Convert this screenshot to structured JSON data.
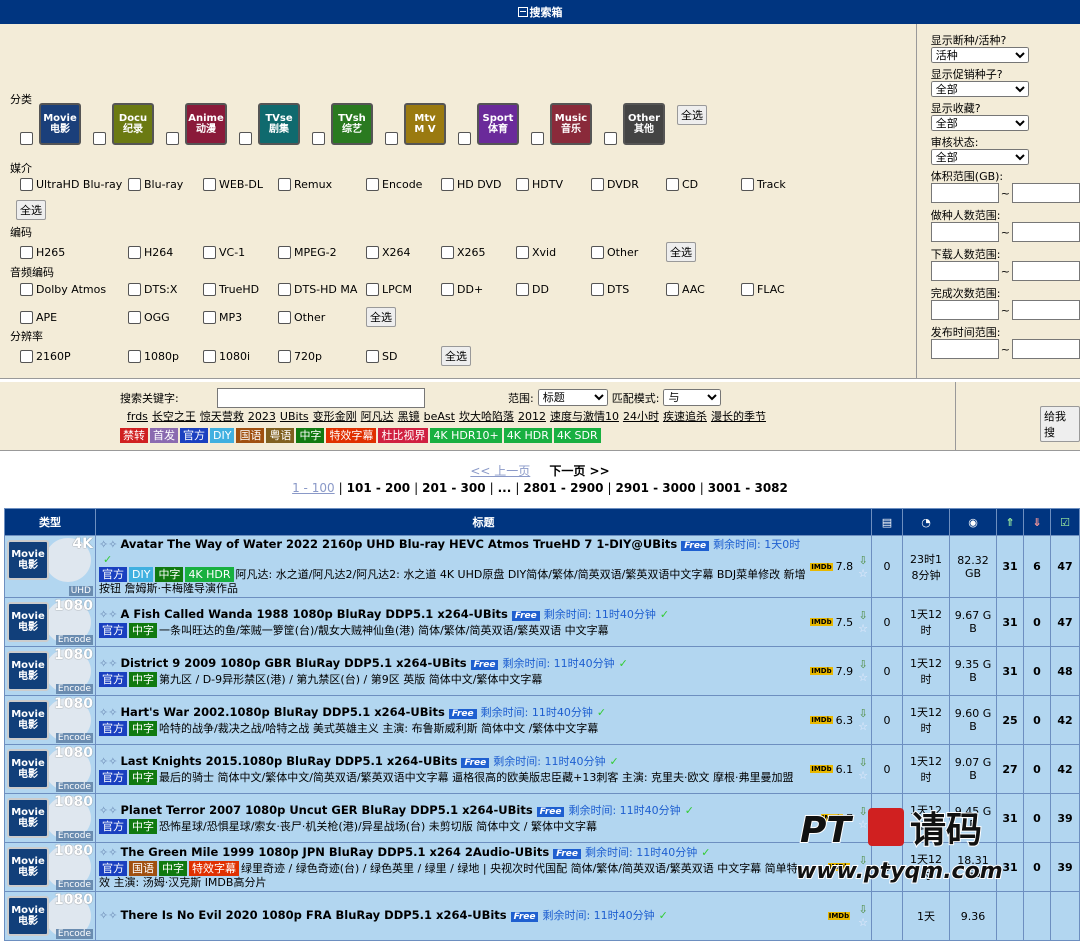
{
  "search_box": {
    "title": "搜索箱",
    "toggle_icon": "minus-box-icon"
  },
  "categories": {
    "label": "分类",
    "items": [
      {
        "en": "Movie",
        "zh": "电影",
        "color": "#1a3f7a"
      },
      {
        "en": "Docu",
        "zh": "纪录",
        "color": "#6b7a12"
      },
      {
        "en": "Anime",
        "zh": "动漫",
        "color": "#8a1a3a"
      },
      {
        "en": "TVse",
        "zh": "剧集",
        "color": "#0f6a6e"
      },
      {
        "en": "TVsh",
        "zh": "综艺",
        "color": "#2a7a20"
      },
      {
        "en": "Mtv",
        "zh": "M V",
        "color": "#9a7a10"
      },
      {
        "en": "Sport",
        "zh": "体育",
        "color": "#6a2a9a"
      },
      {
        "en": "Music",
        "zh": "音乐",
        "color": "#8a2a3a"
      },
      {
        "en": "Other",
        "zh": "其他",
        "color": "#444444"
      }
    ],
    "select_all": "全选"
  },
  "medium": {
    "label": "媒介",
    "items": [
      "UltraHD Blu-ray",
      "Blu-ray",
      "WEB-DL",
      "Remux",
      "Encode",
      "HD DVD",
      "HDTV",
      "DVDR",
      "CD",
      "Track"
    ],
    "select_all": "全选"
  },
  "codec": {
    "label": "编码",
    "items": [
      "H265",
      "H264",
      "VC-1",
      "MPEG-2",
      "X264",
      "X265",
      "Xvid",
      "Other"
    ],
    "select_all": "全选"
  },
  "audio": {
    "label": "音频编码",
    "items": [
      "Dolby Atmos",
      "DTS:X",
      "TrueHD",
      "DTS-HD MA",
      "LPCM",
      "DD+",
      "DD",
      "DTS",
      "AAC",
      "FLAC",
      "APE",
      "OGG",
      "MP3",
      "Other"
    ],
    "select_all": "全选"
  },
  "resolution": {
    "label": "分辨率",
    "items": [
      "2160P",
      "1080p",
      "1080i",
      "720p",
      "SD"
    ],
    "select_all": "全选"
  },
  "filters": {
    "dead_label": "显示断种/活种?",
    "dead_value": "活种",
    "promo_label": "显示促销种子?",
    "promo_value": "全部",
    "fav_label": "显示收藏?",
    "fav_value": "全部",
    "audit_label": "审核状态:",
    "audit_value": "全部",
    "size_label": "体积范围(GB):",
    "seeders_label": "做种人数范围:",
    "leechers_label": "下载人数范围:",
    "completed_label": "完成次数范围:",
    "date_label": "发布时间范围:",
    "tilde": "~"
  },
  "search": {
    "keyword_label": "搜索关键字:",
    "scope_label": "范围:",
    "scope_value": "标题",
    "match_label": "匹配模式:",
    "match_value": "与",
    "submit": "给我搜",
    "hot": [
      "frds",
      "长空之王",
      "惊天营救",
      "2023",
      "UBits",
      "变形金刚",
      "阿凡达",
      "黑镜",
      "beAst",
      "坎大哈陷落",
      "2012",
      "速度与激情10",
      "24小时",
      "疾速追杀",
      "漫长的季节"
    ],
    "tags": [
      {
        "t": "禁转",
        "c": "#d02020"
      },
      {
        "t": "首发",
        "c": "#8a6ab0"
      },
      {
        "t": "官方",
        "c": "#1a40c0"
      },
      {
        "t": "DIY",
        "c": "#40b0e0"
      },
      {
        "t": "国语",
        "c": "#a05010"
      },
      {
        "t": "粤语",
        "c": "#806020"
      },
      {
        "t": "中字",
        "c": "#107a10"
      },
      {
        "t": "特效字幕",
        "c": "#e03000"
      },
      {
        "t": "杜比视界",
        "c": "#d02040"
      },
      {
        "t": "4K HDR10+",
        "c": "#18b040"
      },
      {
        "t": "4K HDR",
        "c": "#18b040"
      },
      {
        "t": "4K SDR",
        "c": "#18b040"
      }
    ]
  },
  "pager": {
    "prev": "<< 上一页",
    "next": "下一页 >>",
    "pages": [
      "1 - 100",
      "101 - 200",
      "201 - 300",
      "...",
      "2801 - 2900",
      "2901 - 3000",
      "3001 - 3082"
    ],
    "sep": "|"
  },
  "table": {
    "headers": [
      "类型",
      "标题"
    ],
    "header_icons": [
      "comments-icon",
      "clock-icon",
      "size-icon",
      "seeders-icon",
      "leechers-icon",
      "completed-icon"
    ],
    "rows": [
      {
        "res": "4K",
        "media": "UHD",
        "title": "Avatar The Way of Water 2022 2160p UHD Blu-ray HEVC Atmos TrueHD 7 1-DIY@UBits",
        "free": "Free",
        "remaining": "剩余时间: 1天0时",
        "tags": [
          "官方",
          "DIY",
          "中字",
          "4K HDR"
        ],
        "desc": "阿凡达: 水之道/阿凡达2/阿凡达2: 水之道 4K UHD原盘 DIY简体/繁体/简英双语/繁英双语中文字幕 BDJ菜单修改 新增按钮 詹姆斯·卡梅隆导演作品",
        "rating": "7.8",
        "comments": "0",
        "time": "23时18分钟",
        "size": "82.32 GB",
        "seeders": "31",
        "leechers": "6",
        "done": "47"
      },
      {
        "res": "1080",
        "media": "Encode",
        "title": "A Fish Called Wanda 1988 1080p BluRay DDP5.1 x264-UBits",
        "free": "Free",
        "remaining": "剩余时间: 11时40分钟",
        "tags": [
          "官方",
          "中字"
        ],
        "desc": "一条叫旺达的鱼/笨贼一箩筐(台)/靓女大贼神仙鱼(港) 简体/繁体/简英双语/繁英双语 中文字幕",
        "rating": "7.5",
        "comments": "0",
        "time": "1天12时",
        "size": "9.67 GB",
        "seeders": "31",
        "leechers": "0",
        "done": "47"
      },
      {
        "res": "1080",
        "media": "Encode",
        "title": "District 9 2009 1080p GBR BluRay DDP5.1 x264-UBits",
        "free": "Free",
        "remaining": "剩余时间: 11时40分钟",
        "tags": [
          "官方",
          "中字"
        ],
        "desc": "第九区 / D-9异形禁区(港) / 第九禁区(台) / 第9区 英版 简体中文/繁体中文字幕",
        "rating": "7.9",
        "comments": "0",
        "time": "1天12时",
        "size": "9.35 GB",
        "seeders": "31",
        "leechers": "0",
        "done": "48"
      },
      {
        "res": "1080",
        "media": "Encode",
        "title": "Hart's War 2002.1080p BluRay DDP5.1 x264-UBits",
        "free": "Free",
        "remaining": "剩余时间: 11时40分钟",
        "tags": [
          "官方",
          "中字"
        ],
        "desc": "哈特的战争/裁决之战/哈特之战 美式英雄主义 主演: 布鲁斯威利斯 简体中文 /繁体中文字幕",
        "rating": "6.3",
        "comments": "0",
        "time": "1天12时",
        "size": "9.60 GB",
        "seeders": "25",
        "leechers": "0",
        "done": "42"
      },
      {
        "res": "1080",
        "media": "Encode",
        "title": "Last Knights 2015.1080p BluRay DDP5.1 x264-UBits",
        "free": "Free",
        "remaining": "剩余时间: 11时40分钟",
        "tags": [
          "官方",
          "中字"
        ],
        "desc": "最后的骑士 简体中文/繁体中文/简英双语/繁英双语中文字幕 逼格很高的欧美版忠臣藏+13刺客 主演: 克里夫·欧文 摩根·弗里曼加盟",
        "rating": "6.1",
        "comments": "0",
        "time": "1天12时",
        "size": "9.07 GB",
        "seeders": "27",
        "leechers": "0",
        "done": "42"
      },
      {
        "res": "1080",
        "media": "Encode",
        "title": "Planet Terror 2007 1080p Uncut GER BluRay DDP5.1 x264-UBits",
        "free": "Free",
        "remaining": "剩余时间: 11时40分钟",
        "tags": [
          "官方",
          "中字"
        ],
        "desc": "恐怖星球/恐惧星球/索女·丧尸·机关枪(港)/异星战场(台) 未剪切版 简体中文 / 繁体中文字幕",
        "rating": "7",
        "comments": "0",
        "time": "1天12时",
        "size": "9.45 GB",
        "seeders": "31",
        "leechers": "0",
        "done": "39"
      },
      {
        "res": "1080",
        "media": "Encode",
        "title": "The Green Mile 1999 1080p JPN BluRay DDP5.1 x264 2Audio-UBits",
        "free": "Free",
        "remaining": "剩余时间: 11时40分钟",
        "tags": [
          "官方",
          "国语",
          "中字",
          "特效字幕"
        ],
        "desc": "绿里奇迹 / 绿色奇迹(台) / 绿色英里 / 绿里 / 绿地 | 央视次时代国配 简体/繁体/简英双语/繁英双语 中文字幕 简单特效 主演: 汤姆·汉克斯 IMDB高分片",
        "rating": "",
        "comments": "0",
        "time": "1天12时",
        "size": "18.31 GB",
        "seeders": "31",
        "leechers": "0",
        "done": "39"
      },
      {
        "res": "1080",
        "media": "Encode",
        "title": "There Is No Evil 2020 1080p FRA BluRay DDP5.1 x264-UBits",
        "free": "Free",
        "remaining": "剩余时间: 11时40分钟",
        "tags": [],
        "desc": "",
        "rating": "",
        "comments": "",
        "time": "1天",
        "size": "9.36",
        "seeders": "",
        "leechers": "",
        "done": ""
      }
    ]
  },
  "watermark": {
    "logo": "PT邀请码",
    "url": "www.ptyqm.com"
  }
}
